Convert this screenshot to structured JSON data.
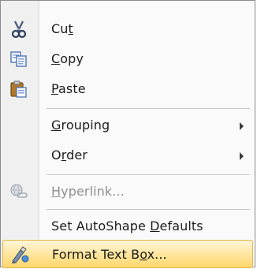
{
  "menu": {
    "items": [
      {
        "label_pre": "Cu",
        "label_acc": "t",
        "label_post": "",
        "icon": "scissors-icon"
      },
      {
        "label_pre": "",
        "label_acc": "C",
        "label_post": "opy",
        "icon": "copy-icon"
      },
      {
        "label_pre": "",
        "label_acc": "P",
        "label_post": "aste",
        "icon": "paste-icon"
      },
      {
        "label_pre": "",
        "label_acc": "G",
        "label_post": "rouping",
        "icon": ""
      },
      {
        "label_pre": "O",
        "label_acc": "r",
        "label_post": "der",
        "icon": ""
      },
      {
        "label_pre": "",
        "label_acc": "H",
        "label_post": "yperlink...",
        "icon": "hyperlink-icon"
      },
      {
        "label_pre": "Set AutoShape ",
        "label_acc": "D",
        "label_post": "efaults",
        "icon": ""
      },
      {
        "label_pre": "Format Text B",
        "label_acc": "o",
        "label_post": "x...",
        "icon": "format-text-box-icon"
      }
    ]
  },
  "colors": {
    "hover_border": "#e3b54b",
    "hover_fill": "#ffe49a",
    "disabled_text": "#8f8f8f"
  }
}
